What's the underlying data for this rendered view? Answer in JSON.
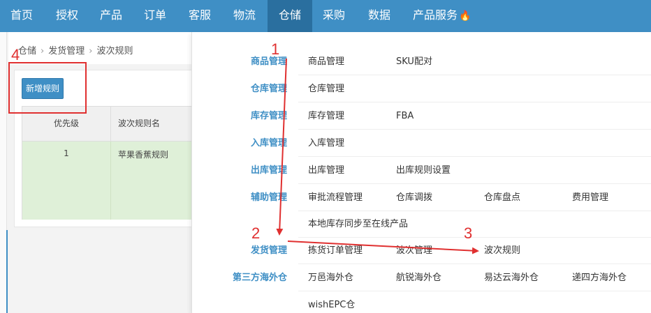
{
  "nav": {
    "items": [
      "首页",
      "授权",
      "产品",
      "订单",
      "客服",
      "物流",
      "仓储",
      "采购",
      "数据",
      "产品服务"
    ],
    "active": "仓储",
    "fire_icon": "fire-icon"
  },
  "breadcrumb": [
    "仓储",
    "发货管理",
    "波次规则"
  ],
  "toolbar": {
    "add_label": "新增规则"
  },
  "table": {
    "headers": [
      "优先级",
      "波次规则名"
    ],
    "rows": [
      {
        "priority": "1",
        "name": "苹果香蕉规则"
      }
    ]
  },
  "menu": [
    {
      "category": "商品管理",
      "links": [
        "商品管理",
        "SKU配对"
      ]
    },
    {
      "category": "仓库管理",
      "links": [
        "仓库管理"
      ]
    },
    {
      "category": "库存管理",
      "links": [
        "库存管理",
        "FBA"
      ]
    },
    {
      "category": "入库管理",
      "links": [
        "入库管理"
      ]
    },
    {
      "category": "出库管理",
      "links": [
        "出库管理",
        "出库规则设置"
      ]
    },
    {
      "category": "辅助管理",
      "links": [
        "审批流程管理",
        "仓库调拨",
        "仓库盘点",
        "费用管理"
      ]
    },
    {
      "category": "",
      "links": [
        "本地库存同步至在线产品"
      ]
    },
    {
      "category": "发货管理",
      "links": [
        "拣货订单管理",
        "波次管理",
        "波次规则"
      ]
    },
    {
      "category": "第三方海外仓",
      "links": [
        "万邑海外仓",
        "航锐海外仓",
        "易达云海外仓",
        "递四方海外仓"
      ]
    },
    {
      "category": "",
      "links": [
        "wishEPC仓"
      ]
    }
  ],
  "annotations": [
    "1",
    "2",
    "3",
    "4"
  ],
  "colors": {
    "nav_bg": "#3f8fc5",
    "nav_active": "#2a6f9f",
    "accent": "#3f8fc5",
    "annotation": "#e03030",
    "row_bg": "#dff0d8"
  }
}
